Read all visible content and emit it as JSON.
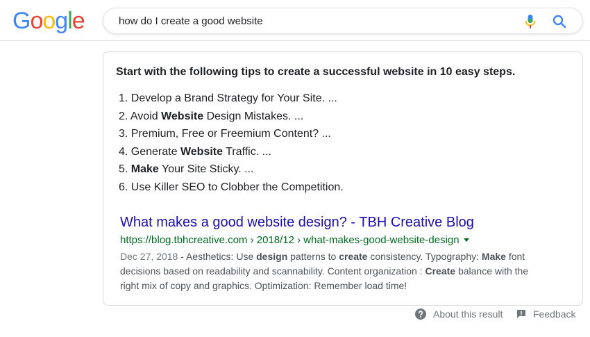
{
  "logo": {
    "letters": [
      "G",
      "o",
      "o",
      "g",
      "l",
      "e"
    ],
    "colors": [
      "#4285F4",
      "#EA4335",
      "#FBBC05",
      "#4285F4",
      "#34A853",
      "#EA4335"
    ]
  },
  "search": {
    "query": "how do I create a good website"
  },
  "featured_snippet": {
    "heading": "Start with the following tips to create a successful website in 10 easy steps.",
    "tips": [
      [
        {
          "t": "1. Develop a Brand Strategy for Your Site. ...",
          "b": false
        }
      ],
      [
        {
          "t": "2. Avoid ",
          "b": false
        },
        {
          "t": "Website",
          "b": true
        },
        {
          "t": " Design Mistakes. ...",
          "b": false
        }
      ],
      [
        {
          "t": "3. Premium, Free or Freemium Content? ...",
          "b": false
        }
      ],
      [
        {
          "t": "4. Generate ",
          "b": false
        },
        {
          "t": "Website",
          "b": true
        },
        {
          "t": " Traffic. ...",
          "b": false
        }
      ],
      [
        {
          "t": "5. ",
          "b": false
        },
        {
          "t": "Make",
          "b": true
        },
        {
          "t": " Your Site Sticky. ...",
          "b": false
        }
      ],
      [
        {
          "t": "6. Use Killer SEO to Clobber the Competition.",
          "b": false
        }
      ]
    ]
  },
  "result": {
    "title": "What makes a good website design? - TBH Creative Blog",
    "url": "https://blog.tbhcreative.com › 2018/12 › what-makes-good-website-design",
    "date": "Dec 27, 2018",
    "snippet": [
      {
        "t": " - Aesthetics: Use ",
        "b": false
      },
      {
        "t": "design",
        "b": true
      },
      {
        "t": " patterns to ",
        "b": false
      },
      {
        "t": "create",
        "b": true
      },
      {
        "t": " consistency. Typography: ",
        "b": false
      },
      {
        "t": "Make",
        "b": true
      },
      {
        "t": " font decisions based on readability and scannability. Content organization : ",
        "b": false
      },
      {
        "t": "Create",
        "b": true
      },
      {
        "t": " balance with the right mix of copy and graphics. Optimization: Remember load time!",
        "b": false
      }
    ]
  },
  "footer": {
    "about_label": "About this result",
    "feedback_label": "Feedback"
  },
  "icons": {
    "mic": "microphone-icon",
    "search": "magnifier-icon",
    "about": "question-circle-icon",
    "feedback": "feedback-flag-icon"
  },
  "colors": {
    "link": "#1a0dab",
    "url": "#006621",
    "accent_blue": "#4285F4"
  }
}
